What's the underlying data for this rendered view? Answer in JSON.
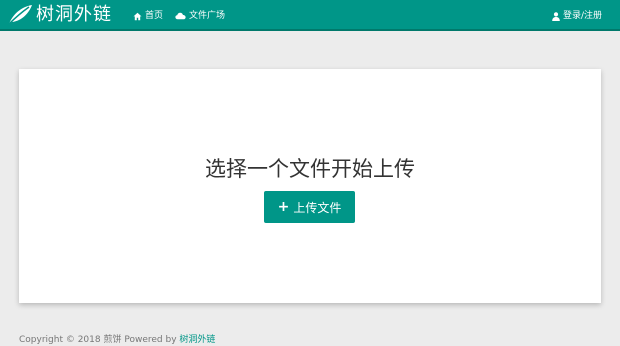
{
  "colors": {
    "accent": "#009688",
    "accent_dark": "#00796b",
    "background": "#ececec",
    "card": "#ffffff"
  },
  "header": {
    "brand": "树洞外链",
    "logo_icon": "leaf-icon",
    "nav": [
      {
        "label": "首页",
        "icon": "home-icon"
      },
      {
        "label": "文件广场",
        "icon": "cloud-icon"
      }
    ],
    "login": {
      "label": "登录/注册",
      "icon": "user-icon"
    }
  },
  "main": {
    "prompt": "选择一个文件开始上传",
    "upload_button": {
      "label": "上传文件",
      "icon": "plus-icon"
    }
  },
  "footer": {
    "copyright": "Copyright © 2018",
    "author": "煎饼",
    "powered": "Powered by",
    "powered_link": "树洞外链"
  }
}
